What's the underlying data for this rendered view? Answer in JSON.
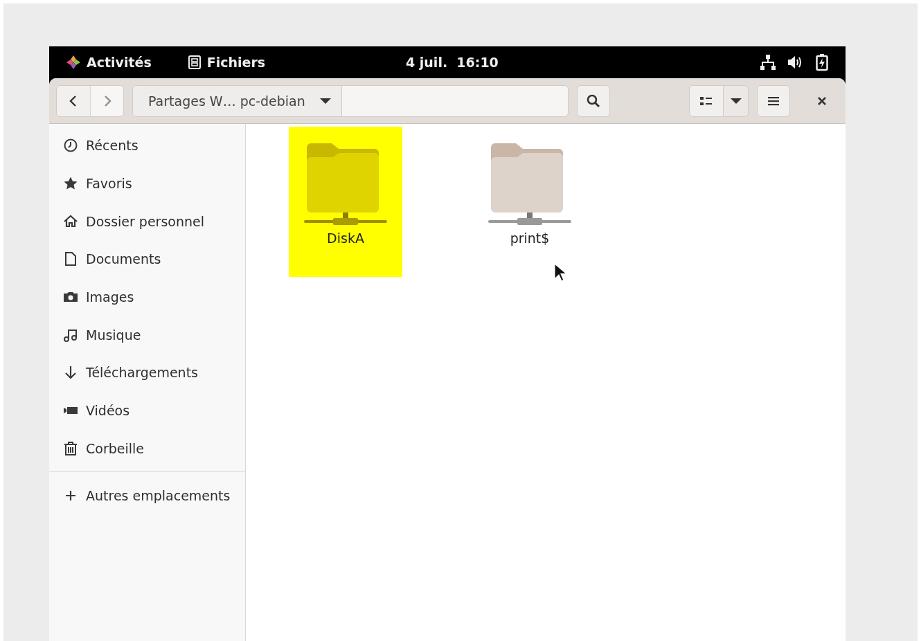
{
  "top_bar": {
    "activities": "Activités",
    "app_name": "Fichiers",
    "clock": "4 juil.  16:10"
  },
  "header_bar": {
    "back_disabled": false,
    "forward_disabled": true,
    "path_button": "Partages W… pc-debian"
  },
  "sidebar": {
    "items": [
      {
        "label": "Récents",
        "kind": "recent",
        "selected": false
      },
      {
        "label": "Favoris",
        "kind": "starred",
        "selected": false
      },
      {
        "label": "Dossier personnel",
        "kind": "home",
        "selected": false
      },
      {
        "label": "Documents",
        "kind": "documents",
        "selected": false
      },
      {
        "label": "Images",
        "kind": "pictures",
        "selected": false
      },
      {
        "label": "Musique",
        "kind": "music",
        "selected": false
      },
      {
        "label": "Téléchargements",
        "kind": "downloads",
        "selected": false
      },
      {
        "label": "Vidéos",
        "kind": "videos",
        "selected": false
      },
      {
        "label": "Corbeille",
        "kind": "trash",
        "selected": false
      }
    ],
    "other_places": "Autres emplacements"
  },
  "files": [
    {
      "name": "DiskA",
      "highlighted": true
    },
    {
      "name": "print$",
      "highlighted": false
    }
  ]
}
